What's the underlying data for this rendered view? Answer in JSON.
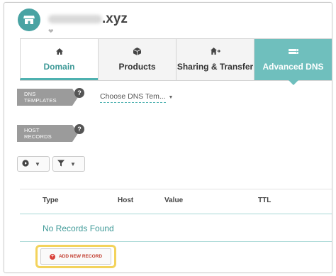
{
  "header": {
    "domain_suffix": ".xyz"
  },
  "tabs": [
    {
      "label": "Domain",
      "icon": "home-icon"
    },
    {
      "label": "Products",
      "icon": "box-icon"
    },
    {
      "label": "Sharing & Transfer",
      "icon": "share-home-icon"
    },
    {
      "label": "Advanced DNS",
      "icon": "server-icon"
    }
  ],
  "dns_templates": {
    "label_line1": "DNS",
    "label_line2": "TEMPLATES",
    "help": "?",
    "select_value": "Choose DNS Tem..."
  },
  "host_records": {
    "label_line1": "HOST",
    "label_line2": "RECORDS",
    "help": "?"
  },
  "table": {
    "columns": [
      "Type",
      "Host",
      "Value",
      "TTL"
    ],
    "empty_message": "No Records Found"
  },
  "add_button": {
    "label": "ADD NEW RECORD"
  },
  "colors": {
    "accent": "#4eb1b0",
    "active_tab": "#6fbfbd",
    "highlight": "#f3d35c",
    "add_icon": "#d9413a"
  }
}
